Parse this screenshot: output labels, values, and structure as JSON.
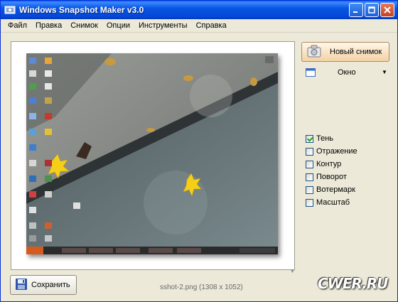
{
  "window": {
    "title": "Windows Snapshot Maker v3.0"
  },
  "menu": [
    {
      "label": "Файл"
    },
    {
      "label": "Правка"
    },
    {
      "label": "Снимок"
    },
    {
      "label": "Опции"
    },
    {
      "label": "Инструменты"
    },
    {
      "label": "Справка"
    }
  ],
  "controls": {
    "snap_label": "Новый снимок",
    "mode_value": "Окно",
    "save_label": "Сохранить"
  },
  "options": [
    {
      "label": "Тень",
      "checked": true
    },
    {
      "label": "Отражение",
      "checked": false
    },
    {
      "label": "Контур",
      "checked": false
    },
    {
      "label": "Поворот",
      "checked": false
    },
    {
      "label": "Вотермарк",
      "checked": false
    },
    {
      "label": "Масштаб",
      "checked": false
    }
  ],
  "status": {
    "file_caption": "sshot-2.png (1308 x 1052)"
  },
  "watermark": {
    "text": "CWER.RU"
  },
  "colors": {
    "titlebar": "#0856e2",
    "snap_button": "#f3d2a4",
    "window_bg": "#ece9d8"
  }
}
